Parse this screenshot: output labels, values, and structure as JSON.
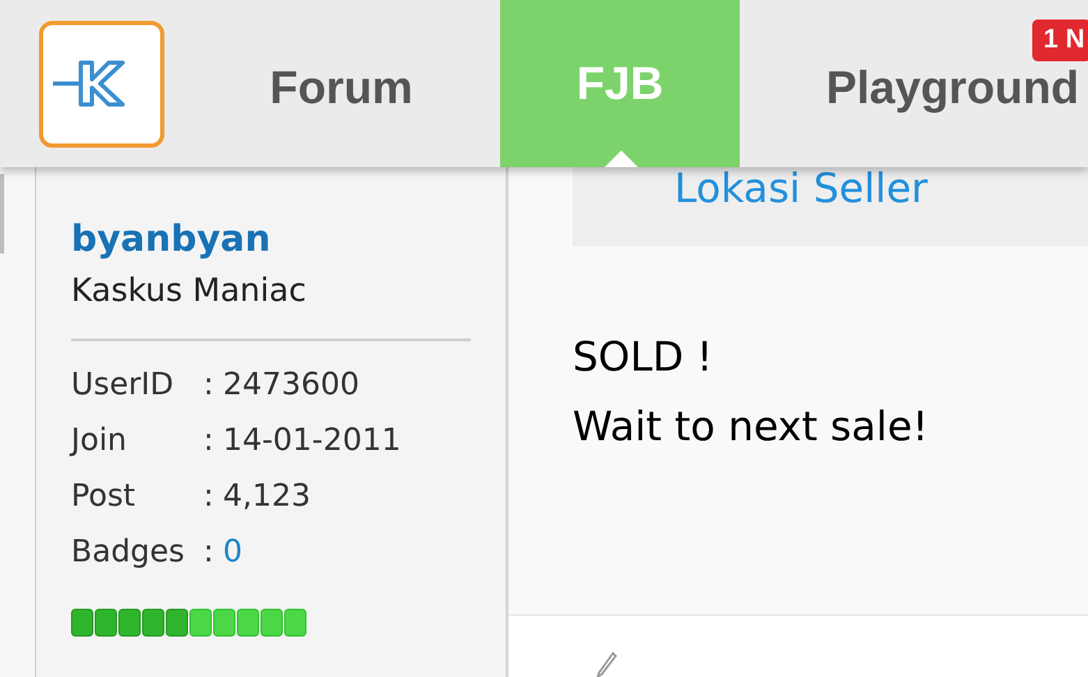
{
  "header": {
    "tabs": [
      {
        "label": "Forum",
        "selected": false
      },
      {
        "label": "FJB",
        "selected": true
      },
      {
        "label": "Playground",
        "selected": false,
        "badge": "1 N"
      }
    ]
  },
  "user": {
    "username": "byanbyan",
    "rank": "Kaskus Maniac",
    "stats": [
      {
        "label": "UserID",
        "separator": ":",
        "value": "2473600",
        "kind": "text"
      },
      {
        "label": "Join",
        "separator": ":",
        "value": "14-01-2011",
        "kind": "text"
      },
      {
        "label": "Post",
        "separator": ":",
        "value": "4,123",
        "kind": "text"
      },
      {
        "label": "Badges",
        "separator": ":",
        "value": "0",
        "kind": "link"
      }
    ]
  },
  "post": {
    "location_link": "Lokasi Seller",
    "lines": [
      "SOLD !",
      "Wait to next sale!"
    ]
  }
}
